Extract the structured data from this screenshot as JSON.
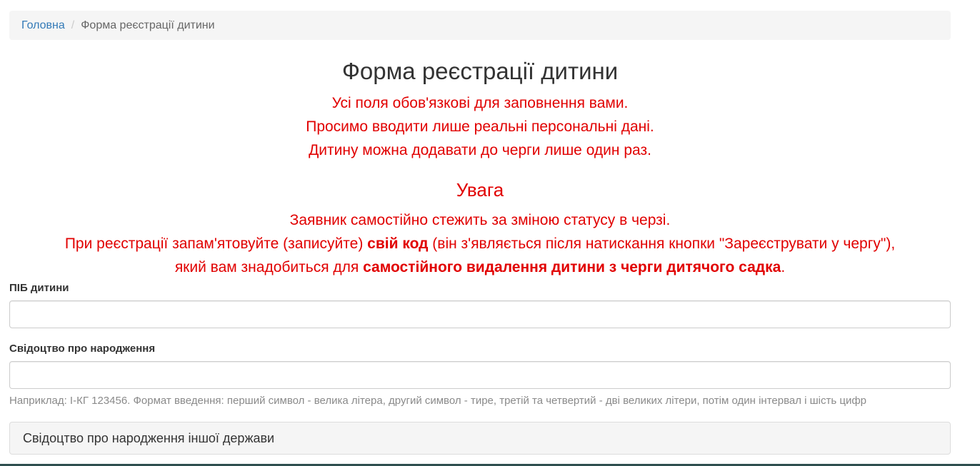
{
  "breadcrumb": {
    "home": "Головна",
    "separator": "/",
    "current": "Форма реєстрації дитини"
  },
  "page_title": "Форма реєстрації дитини",
  "notices": {
    "line1": "Усі поля обов'язкові для заповнення вами.",
    "line2": "Просимо вводити лише реальні персональні дані.",
    "line3": "Дитину можна додавати до черги лише один раз."
  },
  "warning": {
    "title": "Увага",
    "line1": "Заявник самостійно стежить за зміною статусу в черзі.",
    "line2_a": "При реєстрації запам'ятовуйте (записуйте) ",
    "line2_bold": "свій код",
    "line2_b": " (він з'являється після натискання кнопки \"Зареєструвати у чергу\"),",
    "line3_a": "який вам знадобиться для ",
    "line3_bold": "самостійного видалення дитини з черги дитячого садка",
    "line3_b": "."
  },
  "form": {
    "child_name_label": "ПІБ дитини",
    "child_name_value": "",
    "birth_cert_label": "Свідоцтво про народження",
    "birth_cert_value": "",
    "birth_cert_help": "Наприклад: І-КГ 123456. Формат введення: перший символ - велика літера, другий символ - тире, третій та четвертий - дві великих літери, потім один інтервал і шість цифр",
    "other_state_label": "Свідоцтво про народження іншої держави"
  },
  "colors": {
    "warning_red": "#e10000",
    "link_blue": "#337ab7"
  }
}
